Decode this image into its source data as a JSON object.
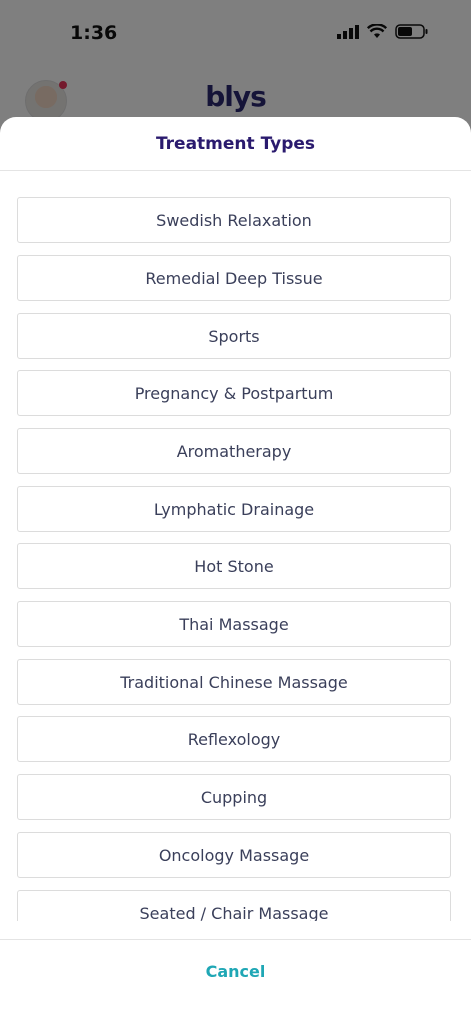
{
  "status_bar": {
    "time": "1:36",
    "icons": [
      "signal-icon",
      "wifi-icon",
      "battery-icon"
    ]
  },
  "app_header": {
    "logo_text": "blys",
    "avatar_icon": "user-avatar"
  },
  "sheet": {
    "title": "Treatment Types",
    "options": [
      "Swedish Relaxation",
      "Remedial Deep Tissue",
      "Sports",
      "Pregnancy & Postpartum",
      "Aromatherapy",
      "Lymphatic Drainage",
      "Hot Stone",
      "Thai Massage",
      "Traditional Chinese Massage",
      "Reflexology",
      "Cupping",
      "Oncology Massage",
      "Seated / Chair Massage"
    ],
    "cancel_label": "Cancel"
  },
  "colors": {
    "title": "#2a1a6e",
    "option_text": "#3a3f5a",
    "cancel": "#1fa7b5",
    "logo": "#2a2870",
    "notification_dot": "#e8345a"
  }
}
